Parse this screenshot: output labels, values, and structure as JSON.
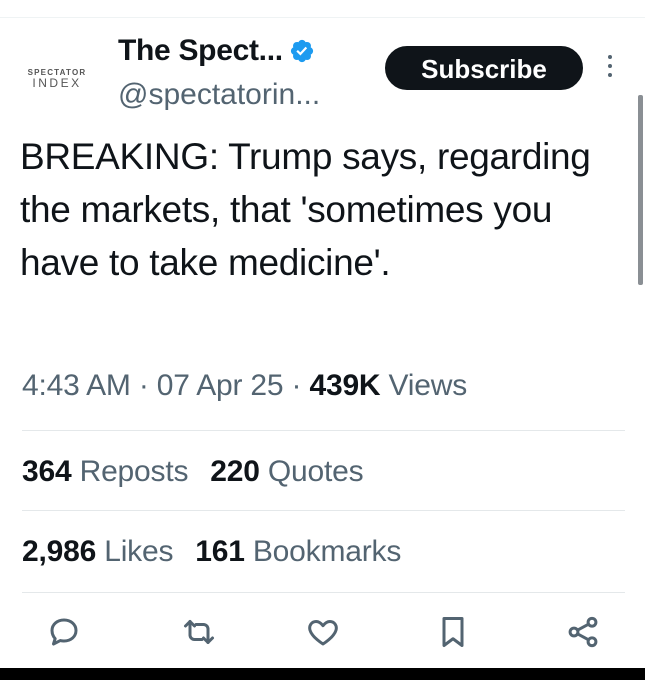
{
  "account": {
    "avatar_top": "SPECTATOR",
    "avatar_bottom": "INDEX",
    "display_name": "The Spect...",
    "handle": "@spectatorin..."
  },
  "subscribe_label": "Subscribe",
  "tweet": {
    "text": "BREAKING: Trump says, regarding the markets, that 'sometimes you have to take medicine'.",
    "time": "4:43 AM",
    "date": "07 Apr 25",
    "views_count": "439K",
    "views_label": "Views",
    "separator": "·"
  },
  "stats": {
    "reposts_count": "364",
    "reposts_label": "Reposts",
    "quotes_count": "220",
    "quotes_label": "Quotes",
    "likes_count": "2,986",
    "likes_label": "Likes",
    "bookmarks_count": "161",
    "bookmarks_label": "Bookmarks"
  },
  "colors": {
    "text": "#0f1419",
    "secondary": "#536471",
    "verified": "#1d9bf0",
    "button": "#0f1419"
  },
  "icons": [
    "reply-icon",
    "repost-icon",
    "like-icon",
    "bookmark-icon",
    "share-icon"
  ]
}
